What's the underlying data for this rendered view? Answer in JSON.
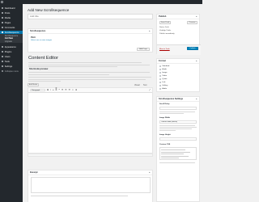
{
  "admin_bar": {
    "logo": "wordpress-icon"
  },
  "sidebar": {
    "items": [
      {
        "label": "Dashboard",
        "icon": "dashboard-icon"
      },
      {
        "label": "Posts",
        "icon": "posts-icon"
      },
      {
        "label": "Media",
        "icon": "media-icon"
      },
      {
        "label": "Pages",
        "icon": "pages-icon"
      },
      {
        "label": "Comments",
        "icon": "comments-icon"
      },
      {
        "label": "Scrollsequence",
        "icon": "scrollsequence-icon"
      },
      {
        "label": "Appearance",
        "icon": "appearance-icon"
      },
      {
        "label": "Plugins",
        "icon": "plugins-icon"
      },
      {
        "label": "Users",
        "icon": "users-icon"
      },
      {
        "label": "Tools",
        "icon": "tools-icon"
      },
      {
        "label": "Settings",
        "icon": "settings-icon"
      },
      {
        "label": "Collapse menu",
        "icon": "collapse-icon"
      }
    ],
    "submenu": [
      {
        "label": "Scrollsequence"
      },
      {
        "label": "Add New"
      },
      {
        "label": "Upgrade"
      }
    ]
  },
  "page": {
    "title": "Add New Scrollsequence",
    "title_placeholder": "Add title"
  },
  "ssq_box": {
    "heading": "Scrollsequence",
    "label": "Pinit",
    "link": "Select one or more images",
    "button": "Add Page"
  },
  "editor": {
    "heading": "Content Editor",
    "shortcode_label": "Shortcode preview",
    "tabs": [
      "Visual",
      "Text"
    ],
    "media_button": "Add Media",
    "format": "Paragraph"
  },
  "excerpt_box": {
    "heading": "Excerpt"
  },
  "publish_box": {
    "heading": "Publish",
    "save_draft": "Save Draft",
    "preview": "Preview",
    "status": "Status: Draft",
    "visibility": "Visibility: Public",
    "publish_immediately": "Publish immediately",
    "trash": "Move to Trash",
    "publish_button": "Publish"
  },
  "format_box": {
    "heading": "Format",
    "options": [
      "Standard",
      "Aside",
      "Image",
      "Video",
      "Quote",
      "Link",
      "Gallery",
      "Audio"
    ]
  },
  "settings_box": {
    "heading": "Scrollsequence Settings",
    "fields": [
      "Scroll Delay",
      "Image Width",
      "Image Height",
      "Custom CSS"
    ],
    "image_width_value": "Contain width (default)"
  }
}
